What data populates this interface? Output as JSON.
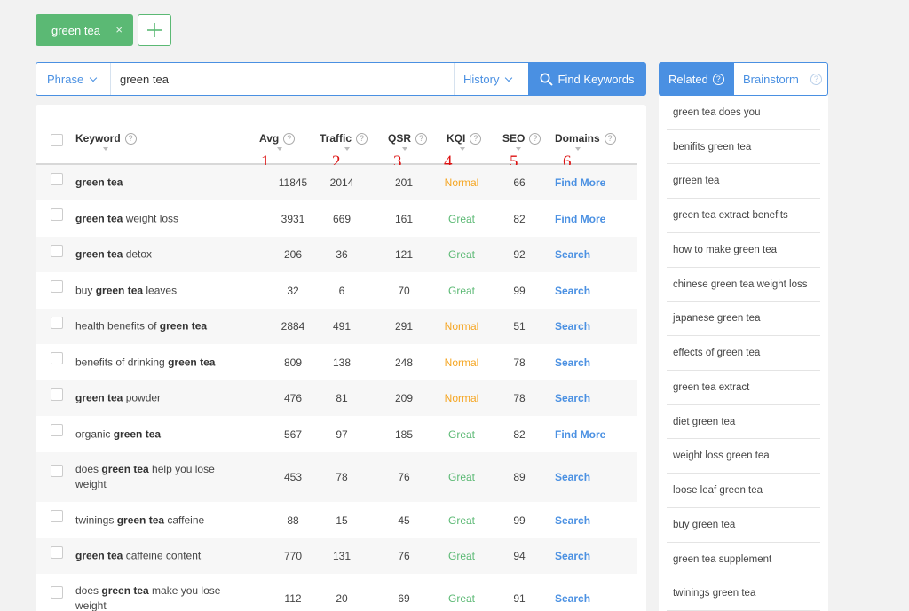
{
  "tags": {
    "active_tag": "green tea",
    "close_glyph": "×"
  },
  "search": {
    "mode_label": "Phrase",
    "query": "green tea",
    "history_label": "History",
    "find_label": "Find Keywords"
  },
  "table": {
    "headers": {
      "keyword": "Keyword",
      "avg": "Avg",
      "traffic": "Traffic",
      "qsr": "QSR",
      "kqi": "KQI",
      "seo": "SEO",
      "domains": "Domains"
    },
    "annotations": [
      "1",
      "2",
      "3",
      "4",
      "5",
      "6"
    ],
    "rows": [
      {
        "pre": "",
        "bold": "green tea",
        "post": "",
        "avg": "11845",
        "traffic": "2014",
        "qsr": "201",
        "kqi": "Normal",
        "seo": "66",
        "domains": "Find More"
      },
      {
        "pre": "",
        "bold": "green tea",
        "post": " weight loss",
        "avg": "3931",
        "traffic": "669",
        "qsr": "161",
        "kqi": "Great",
        "seo": "82",
        "domains": "Find More"
      },
      {
        "pre": "",
        "bold": "green tea",
        "post": " detox",
        "avg": "206",
        "traffic": "36",
        "qsr": "121",
        "kqi": "Great",
        "seo": "92",
        "domains": "Search"
      },
      {
        "pre": "buy ",
        "bold": "green tea",
        "post": " leaves",
        "avg": "32",
        "traffic": "6",
        "qsr": "70",
        "kqi": "Great",
        "seo": "99",
        "domains": "Search"
      },
      {
        "pre": "health benefits of ",
        "bold": "green tea",
        "post": "",
        "avg": "2884",
        "traffic": "491",
        "qsr": "291",
        "kqi": "Normal",
        "seo": "51",
        "domains": "Search"
      },
      {
        "pre": "benefits of drinking ",
        "bold": "green tea",
        "post": "",
        "avg": "809",
        "traffic": "138",
        "qsr": "248",
        "kqi": "Normal",
        "seo": "78",
        "domains": "Search"
      },
      {
        "pre": "",
        "bold": "green tea",
        "post": " powder",
        "avg": "476",
        "traffic": "81",
        "qsr": "209",
        "kqi": "Normal",
        "seo": "78",
        "domains": "Search"
      },
      {
        "pre": "organic ",
        "bold": "green tea",
        "post": "",
        "avg": "567",
        "traffic": "97",
        "qsr": "185",
        "kqi": "Great",
        "seo": "82",
        "domains": "Find More"
      },
      {
        "pre": "does ",
        "bold": "green tea",
        "post": " help you lose weight",
        "avg": "453",
        "traffic": "78",
        "qsr": "76",
        "kqi": "Great",
        "seo": "89",
        "domains": "Search"
      },
      {
        "pre": "twinings ",
        "bold": "green tea",
        "post": " caffeine",
        "avg": "88",
        "traffic": "15",
        "qsr": "45",
        "kqi": "Great",
        "seo": "99",
        "domains": "Search"
      },
      {
        "pre": "",
        "bold": "green tea",
        "post": " caffeine content",
        "avg": "770",
        "traffic": "131",
        "qsr": "76",
        "kqi": "Great",
        "seo": "94",
        "domains": "Search"
      },
      {
        "pre": "does ",
        "bold": "green tea",
        "post": " make you lose weight",
        "avg": "112",
        "traffic": "20",
        "qsr": "69",
        "kqi": "Great",
        "seo": "91",
        "domains": "Search"
      }
    ]
  },
  "sidebar": {
    "tab_related": "Related",
    "tab_brainstorm": "Brainstorm",
    "items": [
      "green tea does you",
      "benifits green tea",
      "grreen tea",
      "green tea extract benefits",
      "how to make green tea",
      "chinese green tea weight loss",
      "japanese green tea",
      "effects of green tea",
      "green tea extract",
      "diet green tea",
      "weight loss green tea",
      "loose leaf green tea",
      "buy green tea",
      "green tea supplement",
      "twinings green tea"
    ]
  },
  "colors": {
    "accent": "#4a90e2",
    "tag_green": "#5bb974",
    "great": "#5bb974",
    "normal": "#f5a623"
  }
}
